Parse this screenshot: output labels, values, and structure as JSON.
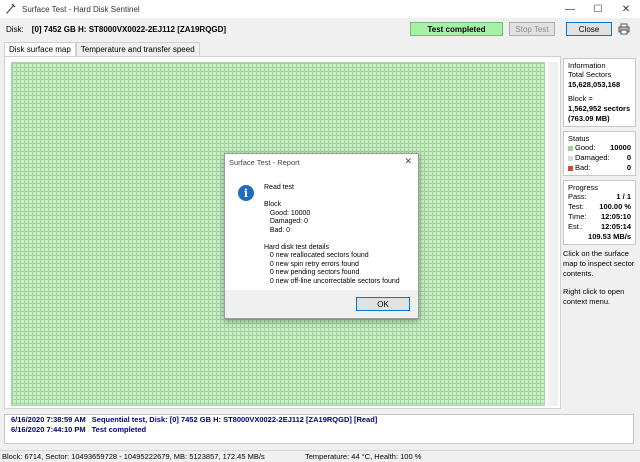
{
  "window": {
    "title": "Surface Test - Hard Disk Sentinel",
    "minimize_glyph": "—",
    "maximize_glyph": "☐",
    "close_glyph": "✕"
  },
  "disk_row": {
    "label": "Disk:",
    "value": "[0] 7452 GB H: ST8000VX0022-2EJ112 [ZA19RQGD]",
    "status": "Test completed",
    "stop_test": "Stop Test",
    "close": "Close"
  },
  "tabs": [
    {
      "label": "Disk surface map"
    },
    {
      "label": "Temperature and transfer speed"
    }
  ],
  "information": {
    "title": "Information",
    "total_sectors_label": "Total Sectors",
    "total_sectors_value": "15,628,053,168",
    "block_label": "Block =",
    "block_value": "1,562,952 sectors",
    "block_size": "(763.09 MB)"
  },
  "status": {
    "title": "Status",
    "good_label": "Good:",
    "good_value": "10000",
    "damaged_label": "Damaged:",
    "damaged_value": "0",
    "bad_label": "Bad:",
    "bad_value": "0"
  },
  "progress": {
    "title": "Progress",
    "pass_label": "Pass:",
    "pass_value": "1 / 1",
    "test_label": "Test:",
    "test_value": "100.00 %",
    "time_label": "Time:",
    "time_value": "12:05:10",
    "est_label": "Est.:",
    "est_value": "12:05:14",
    "speed": "109.53 MB/s"
  },
  "help": {
    "click_text": "Click on the surface map to inspect sector contents.",
    "right_click_text": "Right click to open context menu."
  },
  "log": [
    {
      "time": "6/16/2020  7:38:59 AM",
      "text": "Sequential test, Disk: [0] 7452 GB H: ST8000VX0022-2EJ112 [ZA19RQGD] [Read]"
    },
    {
      "time": "6/16/2020  7:44:10 PM",
      "text": "Test completed"
    }
  ],
  "statusbar": {
    "left": "Block: 6714, Sector: 10493659728 - 10495222679, MB: 5123857, 172.45 MB/s",
    "right": "Temperature: 44  °C,  Health: 100 %"
  },
  "dialog": {
    "title": "Surface Test - Report",
    "close_glyph": "✕",
    "lines": [
      "Read test",
      "",
      "Block",
      "   Good: 10000",
      "   Damaged: 0",
      "   Bad: 0",
      "",
      "Hard disk test details",
      "   0 new reallocated sectors found",
      "   0 new spin retry errors found",
      "   0 new pending sectors found",
      "   0 new off-line uncorrectable sectors found"
    ],
    "ok": "OK"
  },
  "colors": {
    "good": "#9bd58f",
    "damaged": "#d9d9d9",
    "bad": "#d04b3b",
    "status_bg": "#a7f0a7",
    "info_icon": "#1e6dbf"
  }
}
